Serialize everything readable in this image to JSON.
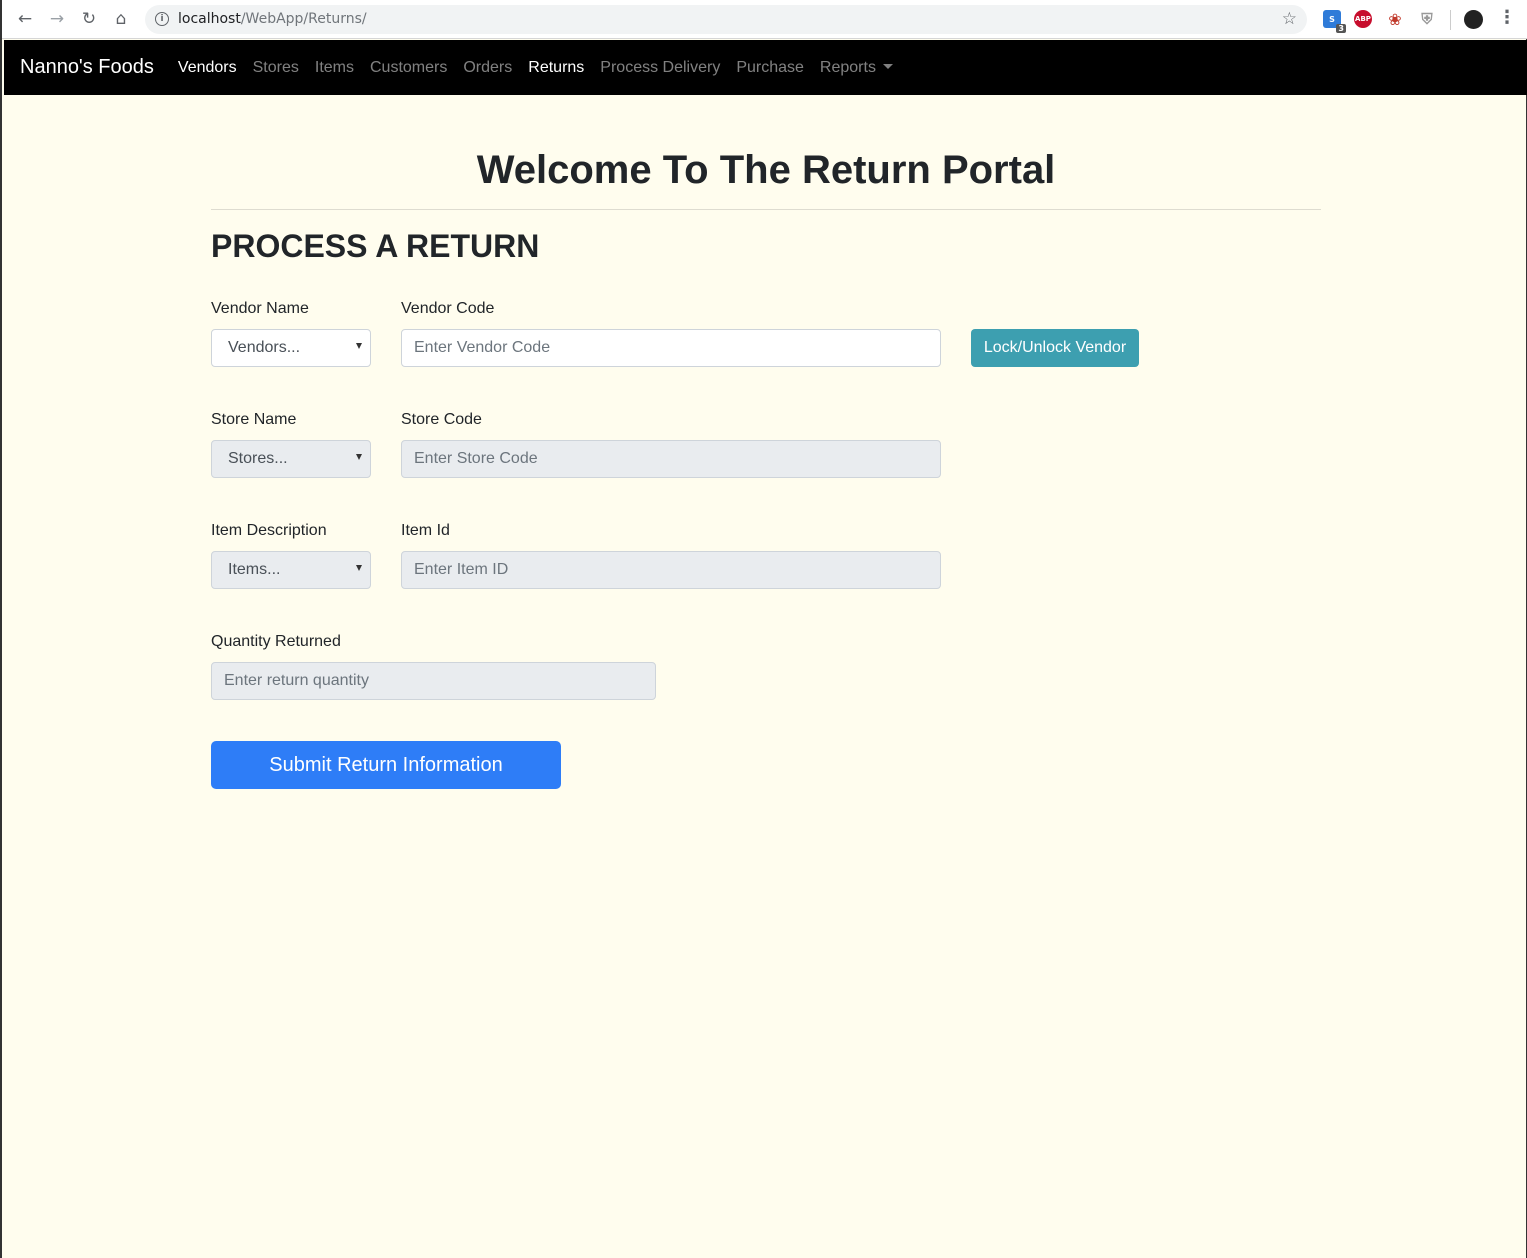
{
  "browser": {
    "url_host": "localhost",
    "url_path": "/WebApp/Returns/",
    "extension_badge": "3",
    "abp_label": "ABP"
  },
  "navbar": {
    "brand": "Nanno's Foods",
    "links": [
      {
        "label": "Vendors",
        "active": true
      },
      {
        "label": "Stores"
      },
      {
        "label": "Items"
      },
      {
        "label": "Customers"
      },
      {
        "label": "Orders"
      },
      {
        "label": "Returns",
        "active": true
      },
      {
        "label": "Process Delivery"
      },
      {
        "label": "Purchase"
      },
      {
        "label": "Reports"
      }
    ]
  },
  "page": {
    "heading": "Welcome To The Return Portal",
    "section_title": "PROCESS A RETURN"
  },
  "form": {
    "vendor_name_label": "Vendor Name",
    "vendor_select": "Vendors...",
    "vendor_code_label": "Vendor Code",
    "vendor_code_placeholder": "Enter Vendor Code",
    "lock_button": "Lock/Unlock Vendor",
    "store_name_label": "Store Name",
    "store_select": "Stores...",
    "store_code_label": "Store Code",
    "store_code_placeholder": "Enter Store Code",
    "item_desc_label": "Item Description",
    "item_select": "Items...",
    "item_id_label": "Item Id",
    "item_id_placeholder": "Enter Item ID",
    "quantity_label": "Quantity Returned",
    "quantity_placeholder": "Enter return quantity",
    "submit_button": "Submit Return Information"
  }
}
